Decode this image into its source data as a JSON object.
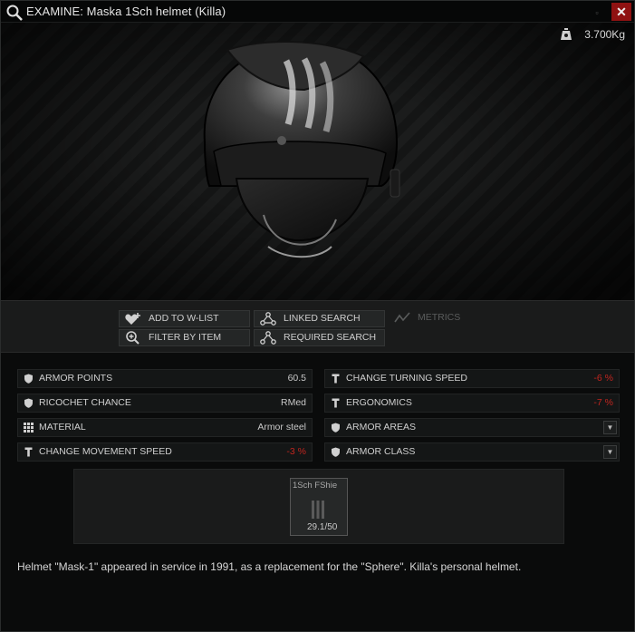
{
  "window": {
    "title": "EXAMINE: Maska 1Sch helmet (Killa)",
    "minimize_label": "▫",
    "close_label": "✕"
  },
  "item": {
    "weight": "3.700Kg"
  },
  "actions": {
    "add_to_wishlist": "ADD TO W-LIST",
    "filter_by_item": "FILTER BY ITEM",
    "linked_search": "LINKED SEARCH",
    "required_search": "REQUIRED SEARCH",
    "metrics": "METRICS"
  },
  "stats_left": [
    {
      "label": "ARMOR POINTS",
      "value": "60.5",
      "icon": "shield-icon"
    },
    {
      "label": "RICOCHET CHANCE",
      "value": "RMed",
      "icon": "shield-icon"
    },
    {
      "label": "MATERIAL",
      "value": "Armor steel",
      "icon": "grid-icon"
    },
    {
      "label": "CHANGE MOVEMENT SPEED",
      "value": "-3 %",
      "icon": "person-icon"
    }
  ],
  "stats_right": [
    {
      "label": "CHANGE TURNING SPEED",
      "value": "-6 %",
      "icon": "person-icon"
    },
    {
      "label": "ERGONOMICS",
      "value": "-7 %",
      "icon": "person-icon"
    },
    {
      "label": "ARMOR AREAS",
      "value": "",
      "icon": "shield-icon"
    },
    {
      "label": "ARMOR CLASS",
      "value": "",
      "icon": "shield-icon"
    }
  ],
  "slot": {
    "name": "1Sch FShie",
    "durability": "29.1/50"
  },
  "description": "Helmet \"Mask-1\" appeared in service in 1991, as a replacement for the \"Sphere\". Killa's personal helmet.",
  "colors": {
    "negative": "#c0251f",
    "close_button": "#8f1212"
  }
}
